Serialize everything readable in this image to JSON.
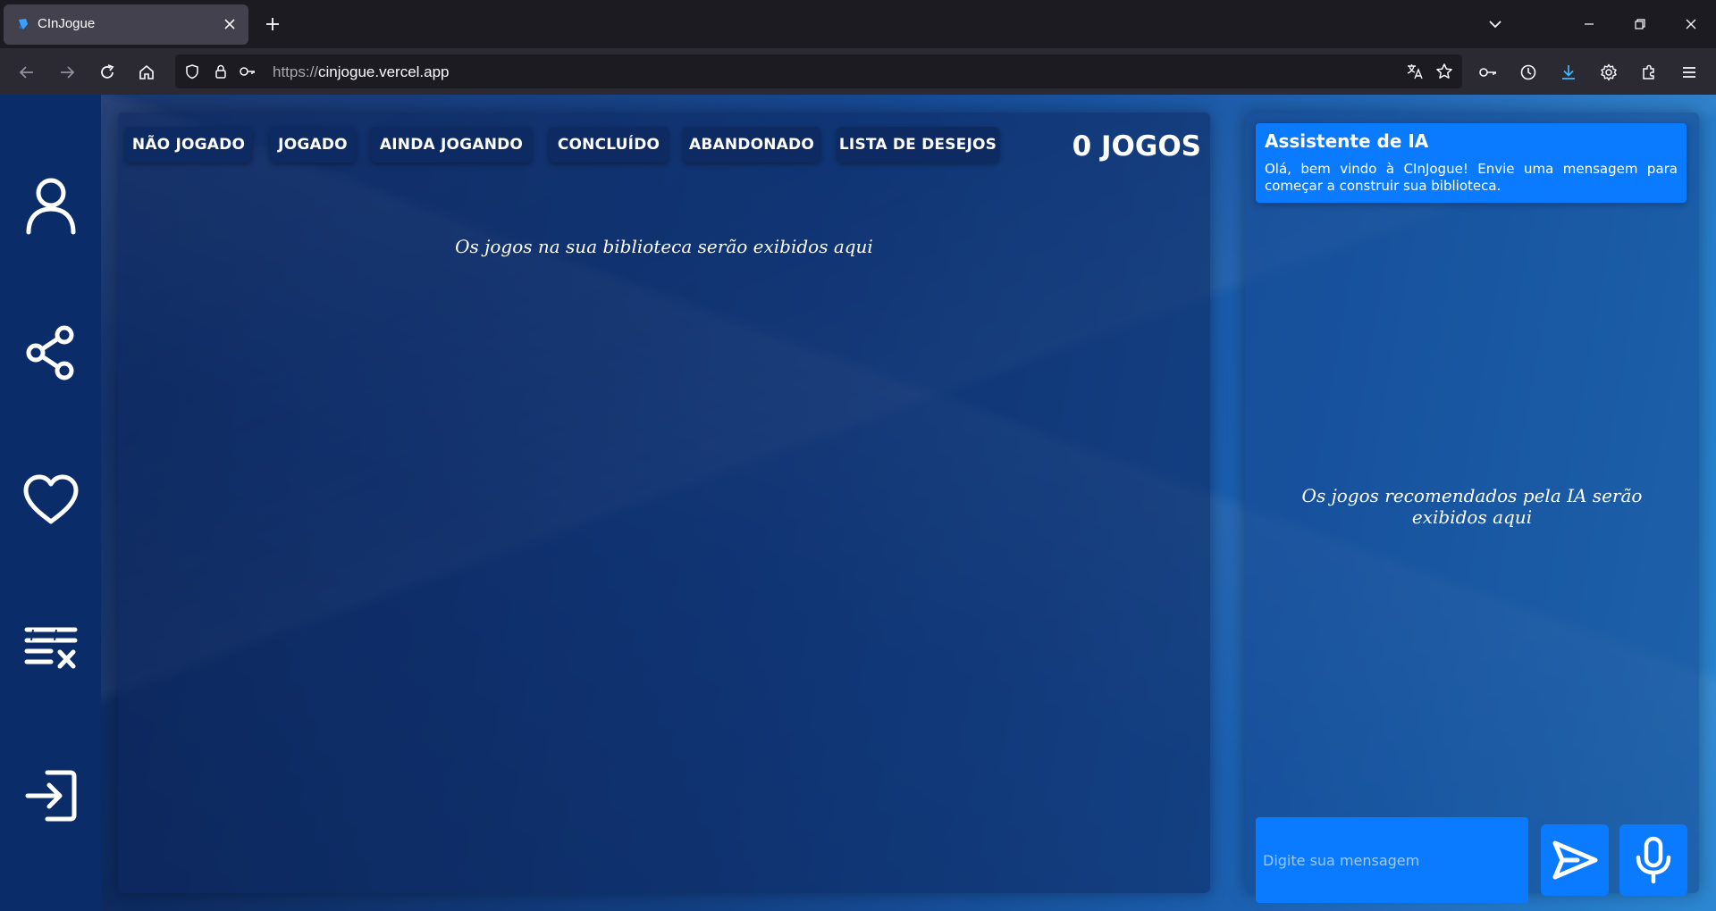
{
  "browser": {
    "tab_title": "CInJogue",
    "url_protocol": "https://",
    "url_host": "cinjogue.vercel.app"
  },
  "sidebar": {
    "items": [
      {
        "icon": "user-icon"
      },
      {
        "icon": "share-icon"
      },
      {
        "icon": "heart-icon"
      },
      {
        "icon": "clear-list-icon"
      },
      {
        "icon": "login-icon"
      }
    ]
  },
  "library": {
    "filters": [
      "NÃO JOGADO",
      "JOGADO",
      "AINDA JOGANDO",
      "CONCLUÍDO",
      "ABANDONADO",
      "LISTA DE DESEJOS"
    ],
    "count_label": "0 JOGOS",
    "empty_text": "Os jogos na sua biblioteca serão exibidos aqui"
  },
  "assistant": {
    "title": "Assistente de IA",
    "welcome": "Olá, bem vindo à CInJogue! Envie uma mensagem para começar a construir sua biblioteca.",
    "empty_text": "Os jogos recomendados pela IA serão exibidos aqui",
    "input_placeholder": "Digite sua mensagem"
  },
  "colors": {
    "accent": "#0a7bff",
    "sidebar": "#0a2d6a",
    "tab_button": "#0d2a62"
  }
}
